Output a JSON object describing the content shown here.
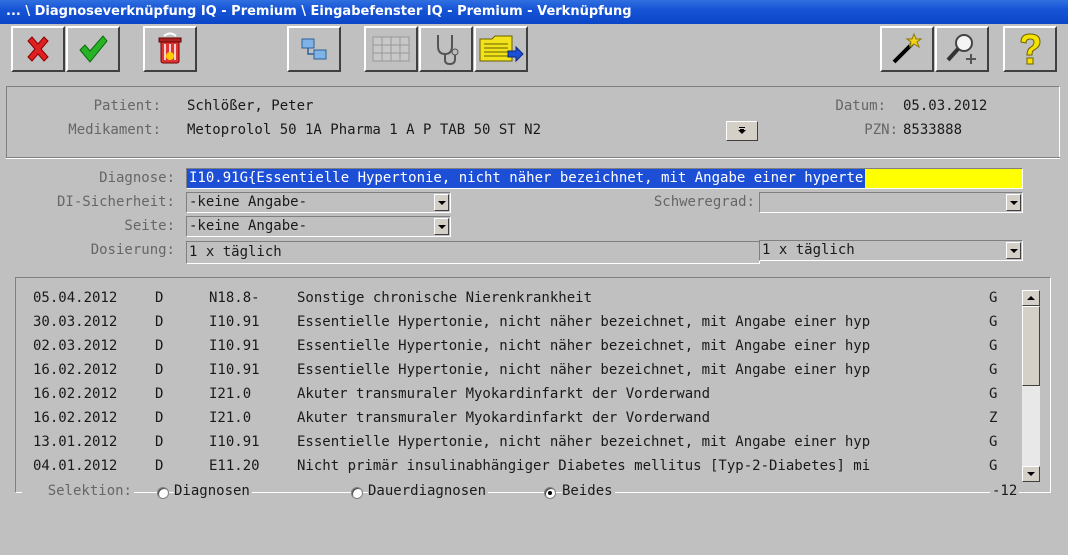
{
  "window": {
    "title": "... \\ Diagnoseverknüpfung IQ - Premium \\ Eingabefenster IQ - Premium - Verknüpfung"
  },
  "toolbar": {
    "buttons": [
      {
        "name": "cancel",
        "icon": "red-x-icon"
      },
      {
        "name": "confirm",
        "icon": "green-check-icon"
      },
      {
        "name": "delete",
        "icon": "trash-bin-icon"
      },
      {
        "name": "link",
        "icon": "network-link-icon"
      },
      {
        "name": "grid",
        "icon": "table-grid-icon"
      },
      {
        "name": "stethoscope",
        "icon": "stethoscope-icon"
      },
      {
        "name": "folder-forward",
        "icon": "folder-arrow-icon"
      },
      {
        "name": "wizard",
        "icon": "magic-wand-icon"
      },
      {
        "name": "search",
        "icon": "magnifier-plus-icon"
      },
      {
        "name": "help",
        "icon": "question-mark-icon"
      }
    ]
  },
  "header": {
    "patient_label": "Patient:",
    "patient_value": "Schlößer, Peter",
    "medikament_label": "Medikament:",
    "medikament_value": "Metoprolol 50 1A Pharma 1 A P TAB 50 ST N2",
    "datum_label": "Datum:",
    "datum_value": "05.03.2012",
    "pzn_label": "PZN:",
    "pzn_value": "8533888"
  },
  "form": {
    "diagnose_label": "Diagnose:",
    "diagnose_value": "I10.91G{Essentielle Hypertonie, nicht näher bezeichnet, mit Angabe einer hyperte",
    "di_sicherheit_label": "DI-Sicherheit:",
    "di_sicherheit_value": "-keine Angabe-",
    "schweregrad_label": "Schweregrad:",
    "schweregrad_value": "",
    "seite_label": "Seite:",
    "seite_value": "-keine Angabe-",
    "dosierung_label": "Dosierung:",
    "dosierung_value": "1 x täglich",
    "dosierung_select": "1 x täglich"
  },
  "list": {
    "rows": [
      {
        "date": "05.04.2012",
        "type": "D",
        "code": "N18.8-",
        "text": "Sonstige chronische Nierenkrankheit",
        "flag": "G"
      },
      {
        "date": "30.03.2012",
        "type": "D",
        "code": "I10.91",
        "text": "Essentielle Hypertonie, nicht näher bezeichnet, mit Angabe einer hyp",
        "flag": "G"
      },
      {
        "date": "02.03.2012",
        "type": "D",
        "code": "I10.91",
        "text": "Essentielle Hypertonie, nicht näher bezeichnet, mit Angabe einer hyp",
        "flag": "G"
      },
      {
        "date": "16.02.2012",
        "type": "D",
        "code": "I10.91",
        "text": "Essentielle Hypertonie, nicht näher bezeichnet, mit Angabe einer hyp",
        "flag": "G"
      },
      {
        "date": "16.02.2012",
        "type": "D",
        "code": "I21.0",
        "text": "Akuter transmuraler Myokardinfarkt der Vorderwand",
        "flag": "G"
      },
      {
        "date": "16.02.2012",
        "type": "D",
        "code": "I21.0",
        "text": "Akuter transmuraler Myokardinfarkt der Vorderwand",
        "flag": "Z"
      },
      {
        "date": "13.01.2012",
        "type": "D",
        "code": "I10.91",
        "text": "Essentielle Hypertonie, nicht näher bezeichnet, mit Angabe einer hyp",
        "flag": "G"
      },
      {
        "date": "04.01.2012",
        "type": "D",
        "code": "E11.20",
        "text": "Nicht primär insulinabhängiger Diabetes mellitus [Typ-2-Diabetes] mi",
        "flag": "G"
      }
    ]
  },
  "selektion": {
    "label": "Selektion:",
    "options": [
      "Diagnosen",
      "Dauerdiagnosen",
      "Beides"
    ],
    "selected": "Beides",
    "count": "-12"
  },
  "colors": {
    "titlebar": "#1654d6",
    "selection": "#1c4fd6",
    "highlight": "#ffff00",
    "background": "#c0c0c0"
  }
}
